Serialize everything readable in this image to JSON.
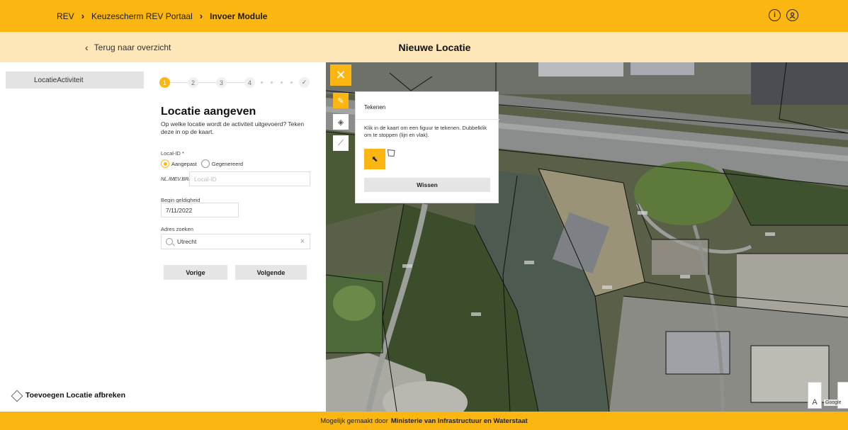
{
  "header": {
    "breadcrumb": [
      "REV",
      "Keuzescherm REV Portaal",
      "Invoer Module"
    ],
    "info_icon": "info-icon",
    "user_icon": "user-icon"
  },
  "subheader": {
    "back_label": "Terug naar overzicht",
    "title": "Nieuwe Locatie"
  },
  "sidebar": {
    "items": [
      {
        "label": "LocatieActiviteit"
      }
    ],
    "abort_label": "Toevoegen Locatie afbreken"
  },
  "form": {
    "steps": [
      "1",
      "2",
      "3",
      "4",
      "✓"
    ],
    "active_step": 1,
    "title": "Locatie aangeven",
    "description": "Op welke locatie wordt de activiteit uitgevoerd? Teken deze in op de kaart.",
    "local_id_label": "Local-ID *",
    "radio_options": [
      "Aangepast",
      "Gegenereerd"
    ],
    "radio_selected": "Aangepast",
    "id_prefix": "NL.IMEV.BRN.",
    "local_id_placeholder": "Local-ID",
    "begin_label": "Begin geldigheid",
    "begin_value": "7/11/2022",
    "address_label": "Adres zoeken",
    "address_value": "Utrecht",
    "prev_label": "Vorige",
    "next_label": "Volgende"
  },
  "map": {
    "draw_panel": {
      "title": "Tekenen",
      "description": "Klik in de kaart om een figuur te tekenen. Dubbelklik om te stoppen (lijn en vlak).",
      "clear_label": "Wissen"
    },
    "zoom_label": "A",
    "attribution": "Google"
  },
  "footer": {
    "prefix": "Mogelijk gemaakt door",
    "org": "Ministerie van Infrastructuur en Waterstaat"
  },
  "colors": {
    "brand": "#fbb612",
    "subbar": "#fde7b8"
  }
}
